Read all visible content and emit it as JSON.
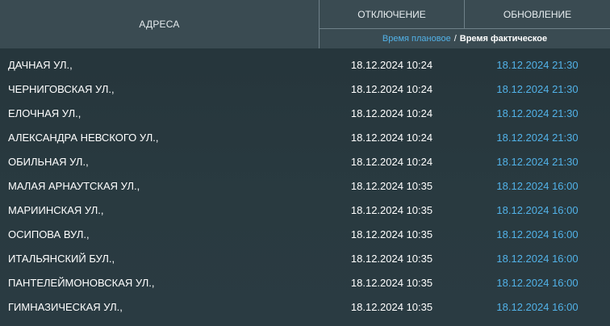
{
  "header": {
    "address_label": "АДРЕСА",
    "outage_label": "ОТКЛЮЧЕНИЕ",
    "update_label": "ОБНОВЛЕНИЕ",
    "legend_planned": "Время плановое",
    "legend_separator": "/",
    "legend_actual": "Время фактическое"
  },
  "colors": {
    "planned_time": "#52b2e8",
    "header_bg": "#3a4b52",
    "table_bg": "#27353b"
  },
  "rows": [
    {
      "address": "ДАЧНАЯ УЛ.,",
      "outage": "18.12.2024 10:24",
      "update": "18.12.2024 21:30"
    },
    {
      "address": "ЧЕРНИГОВСКАЯ УЛ.,",
      "outage": "18.12.2024 10:24",
      "update": "18.12.2024 21:30"
    },
    {
      "address": "ЕЛОЧНАЯ УЛ.,",
      "outage": "18.12.2024 10:24",
      "update": "18.12.2024 21:30"
    },
    {
      "address": "АЛЕКСАНДРА НЕВСКОГО УЛ.,",
      "outage": "18.12.2024 10:24",
      "update": "18.12.2024 21:30"
    },
    {
      "address": "ОБИЛЬНАЯ УЛ.,",
      "outage": "18.12.2024 10:24",
      "update": "18.12.2024 21:30"
    },
    {
      "address": "МАЛАЯ АРНАУТСКАЯ УЛ.,",
      "outage": "18.12.2024 10:35",
      "update": "18.12.2024 16:00"
    },
    {
      "address": "МАРИИНСКАЯ УЛ.,",
      "outage": "18.12.2024 10:35",
      "update": "18.12.2024 16:00"
    },
    {
      "address": "ОСИПОВА ВУЛ.,",
      "outage": "18.12.2024 10:35",
      "update": "18.12.2024 16:00"
    },
    {
      "address": "ИТАЛЬЯНСКИЙ БУЛ.,",
      "outage": "18.12.2024 10:35",
      "update": "18.12.2024 16:00"
    },
    {
      "address": "ПАНТЕЛЕЙМОНОВСКАЯ УЛ.,",
      "outage": "18.12.2024 10:35",
      "update": "18.12.2024 16:00"
    },
    {
      "address": "ГИМНАЗИЧЕСКАЯ УЛ.,",
      "outage": "18.12.2024 10:35",
      "update": "18.12.2024 16:00"
    }
  ]
}
